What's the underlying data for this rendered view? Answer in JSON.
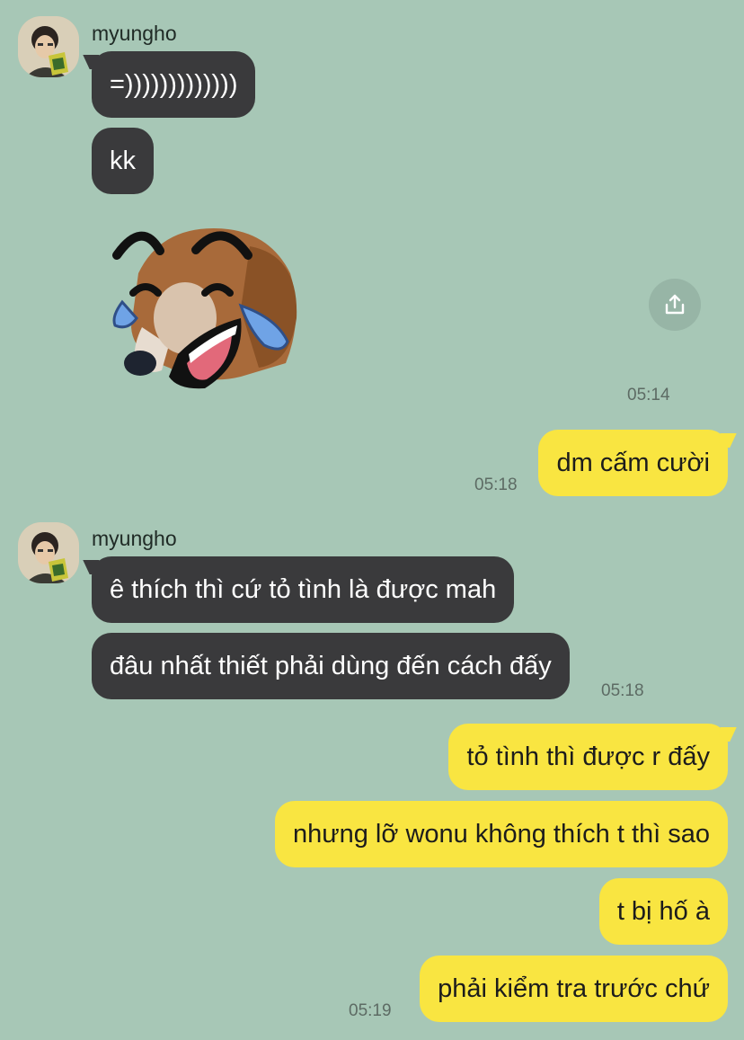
{
  "colors": {
    "background": "#a7c7b6",
    "incoming_bubble": "#3a3a3c",
    "outgoing_bubble": "#f9e541",
    "timestamp": "#5d6b64"
  },
  "chat": {
    "groups": [
      {
        "sender": "myungho",
        "messages": [
          "=)))))))))))))",
          "kk"
        ],
        "sticker": "laughing-dog-sticker",
        "time": "05:14"
      },
      {
        "outgoing": [
          "dm cấm cười"
        ],
        "time": "05:18"
      },
      {
        "sender": "myungho",
        "messages": [
          "ê thích thì cứ tỏ tình là được mah",
          "đâu nhất thiết phải dùng đến cách đấy"
        ],
        "time": "05:18"
      },
      {
        "outgoing": [
          "tỏ tình thì được r đấy",
          "nhưng lỡ wonu không thích t thì sao",
          "t bị hố à",
          "phải kiểm tra trước chứ"
        ],
        "time": "05:19"
      }
    ]
  },
  "icons": {
    "share": "share-upload-icon",
    "avatar": "profile-avatar"
  }
}
